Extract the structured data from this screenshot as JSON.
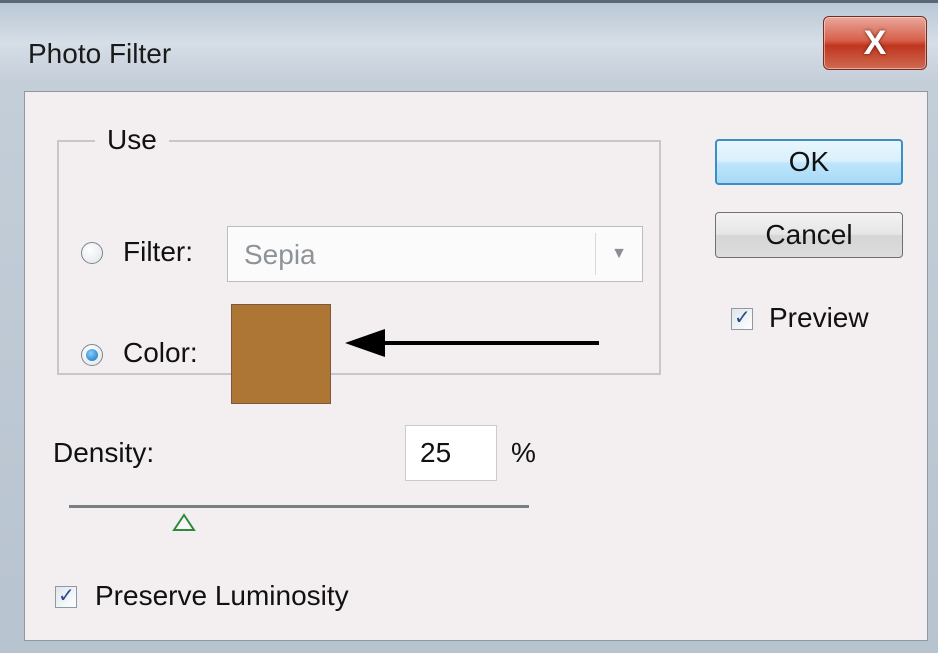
{
  "window": {
    "title": "Photo Filter",
    "close_label": "X"
  },
  "use_group": {
    "legend": "Use",
    "filter_label": "Filter:",
    "filter_value": "Sepia",
    "filter_selected": false,
    "color_label": "Color:",
    "color_selected": true,
    "color_swatch": "#ad7635"
  },
  "buttons": {
    "ok": "OK",
    "cancel": "Cancel"
  },
  "preview": {
    "label": "Preview",
    "checked": true
  },
  "density": {
    "label": "Density:",
    "value": "25",
    "unit": "%",
    "slider_fraction": 0.25
  },
  "preserve_luminosity": {
    "label": "Preserve Luminosity",
    "checked": true
  },
  "icons": {
    "close": "close-icon",
    "dropdown": "chevron-down-icon",
    "annotation": "arrow-left-icon"
  },
  "colors": {
    "default_button_border": "#3c8ec7",
    "close_button": "#c0361f"
  }
}
